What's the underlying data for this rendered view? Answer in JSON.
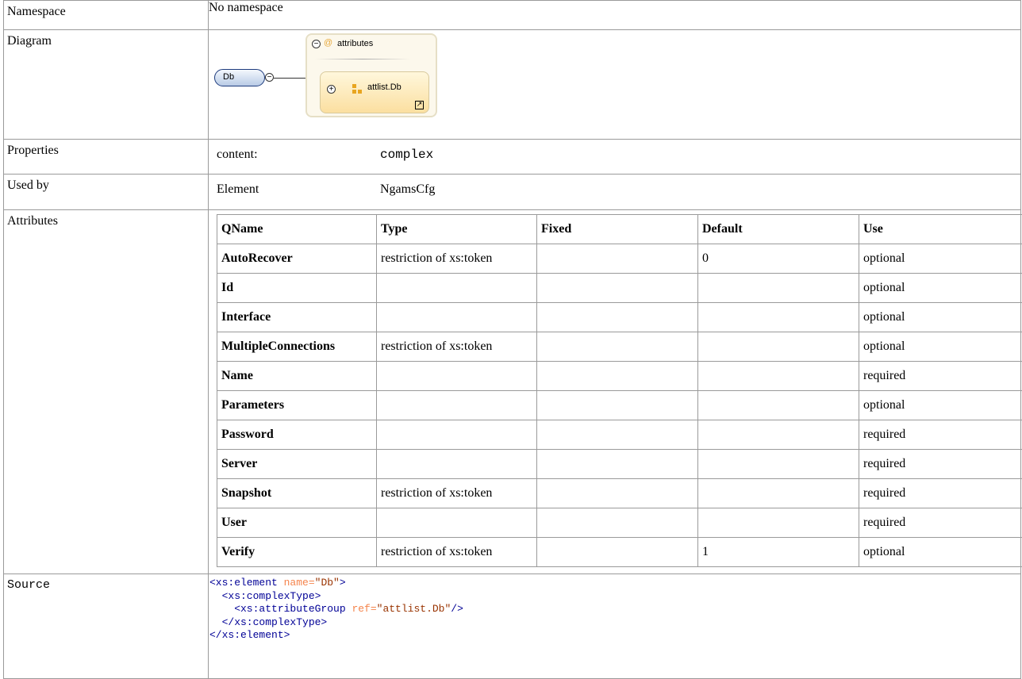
{
  "rows": {
    "namespace": {
      "label": "Namespace",
      "value": "No namespace"
    },
    "diagram": {
      "label": "Diagram",
      "element_name": "Db",
      "group_label": "attributes",
      "group_icon": "@",
      "ref_label": "attlist.Db"
    },
    "properties": {
      "label": "Properties",
      "key": "content:",
      "value": "complex"
    },
    "used_by": {
      "label": "Used by",
      "kind": "Element",
      "value": "NgamsCfg"
    },
    "attributes": {
      "label": "Attributes"
    },
    "source": {
      "label": "Source"
    }
  },
  "attributes_table": {
    "headers": [
      "QName",
      "Type",
      "Fixed",
      "Default",
      "Use"
    ],
    "rows": [
      [
        "AutoRecover",
        "restriction of xs:token",
        "",
        "0",
        "optional"
      ],
      [
        "Id",
        "",
        "",
        "",
        "optional"
      ],
      [
        "Interface",
        "",
        "",
        "",
        "optional"
      ],
      [
        "MultipleConnections",
        "restriction of xs:token",
        "",
        "",
        "optional"
      ],
      [
        "Name",
        "",
        "",
        "",
        "required"
      ],
      [
        "Parameters",
        "",
        "",
        "",
        "optional"
      ],
      [
        "Password",
        "",
        "",
        "",
        "required"
      ],
      [
        "Server",
        "",
        "",
        "",
        "required"
      ],
      [
        "Snapshot",
        "restriction of xs:token",
        "",
        "",
        "required"
      ],
      [
        "User",
        "",
        "",
        "",
        "required"
      ],
      [
        "Verify",
        "restriction of xs:token",
        "",
        "1",
        "optional"
      ]
    ]
  },
  "source_code": {
    "l1_tag": "<xs:element",
    "l1_attr": " name=",
    "l1_val": "\"Db\"",
    "l1_end": ">",
    "l2": "  <xs:complexType>",
    "l3_tag": "    <xs:attributeGroup",
    "l3_attr": " ref=",
    "l3_val": "\"attlist.Db\"",
    "l3_end": "/>",
    "l4": "  </xs:complexType>",
    "l5": "</xs:element>"
  },
  "colors": {
    "tag": "#000096",
    "attr_name": "#f5844c",
    "attr_value": "#993300"
  },
  "icons": [
    "collapse-minus-icon",
    "expand-plus-icon",
    "attribute-at-icon",
    "attribute-group-icon",
    "jump-link-icon"
  ]
}
